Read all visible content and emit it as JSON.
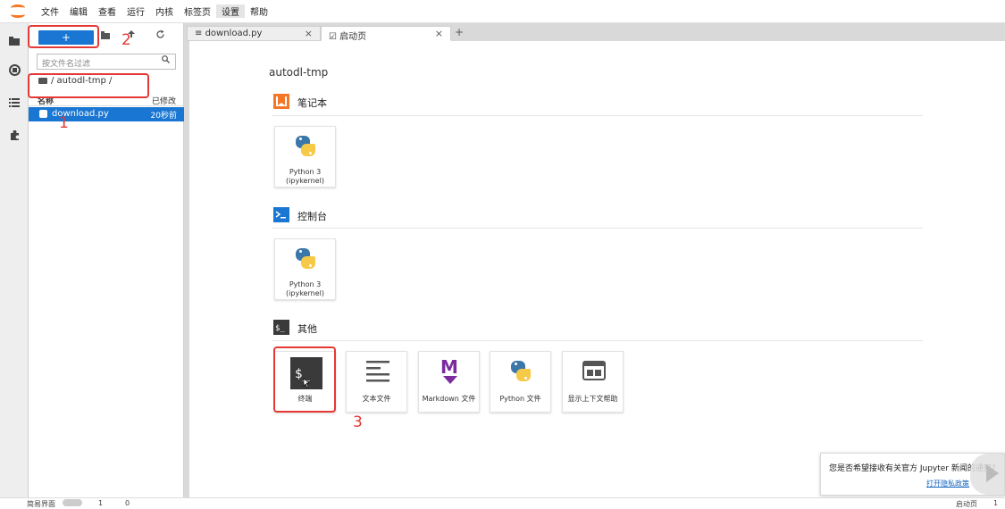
{
  "menubar": {
    "items": [
      "文件",
      "编辑",
      "查看",
      "运行",
      "内核",
      "标签页",
      "设置",
      "帮助"
    ],
    "active_index": 6
  },
  "filebrowser": {
    "new_button_label": "+",
    "filter_placeholder": "按文件名过滤",
    "breadcrumb": "/ autodl-tmp /",
    "col_name": "名称",
    "col_modified": "已修改",
    "files": [
      {
        "name": "download.py",
        "modified": "20秒前"
      }
    ]
  },
  "tabs": [
    {
      "label": "download.py",
      "close": "×"
    },
    {
      "label": "启动页",
      "close": "×"
    }
  ],
  "tab_add": "+",
  "launcher": {
    "path": "autodl-tmp",
    "sections": {
      "notebook": {
        "title": "笔记本",
        "cards": [
          {
            "line1": "Python 3",
            "line2": "(ipykernel)"
          }
        ]
      },
      "console": {
        "title": "控制台",
        "cards": [
          {
            "line1": "Python 3",
            "line2": "(ipykernel)"
          }
        ]
      },
      "other": {
        "title": "其他",
        "cards": [
          "终端",
          "文本文件",
          "Markdown 文件",
          "Python 文件",
          "显示上下文帮助"
        ]
      }
    }
  },
  "annotations": {
    "n1": "1",
    "n2": "2",
    "n3": "3"
  },
  "statusbar": {
    "left_label": "简易界面",
    "k1": "1",
    "k2": "0",
    "right_label": "启动页",
    "right_num": "1"
  },
  "notification": {
    "message": "您是否希望接收有关官方 Jupyter 新闻的通知?",
    "link": "打开隐私政策"
  },
  "colors": {
    "accent": "#1976d2",
    "highlight": "#e53935",
    "jupyter_orange": "#f37726"
  }
}
